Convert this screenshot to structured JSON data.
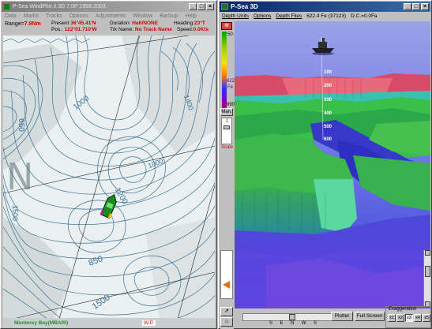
{
  "left_window": {
    "title": "P-Sea WindPlot II 3D 7.0P 1993-2003",
    "menu": [
      "Data",
      "Marks",
      "Tracks",
      "Options",
      "Adjustments",
      "Window",
      "Backup",
      "Help"
    ],
    "range_label": "Range=",
    "range_value": "7.9Nm",
    "present_label": "Present",
    "present_value": "36°45.41'N",
    "pos_label": "Pos.:",
    "pos_value": "122°01.710'W",
    "duration_label": "Duration:",
    "duration_value": "Halt/NONE",
    "heading_label": "Heading:",
    "heading_value": "23°T",
    "trk_label": "Trk Name:",
    "trk_value": "No Track Name",
    "speed_label": "Speed:",
    "speed_value": "0.0Kts",
    "contours": [
      "650",
      "1000",
      "1200",
      "1500",
      "850",
      "1500",
      "1000",
      "1400"
    ],
    "footer_left": "Monterey Bay(MBARI)",
    "footer_right": "W.P."
  },
  "right_window": {
    "title": "P-Sea 3D",
    "menu": [
      "Depth Units",
      "Options",
      "Depth Files"
    ],
    "status_depth": "622.4 Fe (37123)",
    "status_dc": "D.C.=0.0Fa",
    "legend_top": "50.1",
    "legend_mid": "622.4",
    "legend_mid_unit": "Fe",
    "legend_bottom": "990.",
    "man_label": "Man.",
    "man_value": "1",
    "scale_label": "Scale",
    "depth_labels": [
      "100",
      "200",
      "300",
      "400",
      "500",
      "600"
    ],
    "compass": [
      "S",
      "E",
      "N",
      "W",
      "S"
    ],
    "plotter_label": "Plotter",
    "fullscreen_label": "Full Screen",
    "exaggeration_label": "Exaggeration",
    "exag_buttons": [
      "x1",
      "x2",
      "x3",
      "x4",
      "x5"
    ],
    "exag_selected": "x3"
  }
}
